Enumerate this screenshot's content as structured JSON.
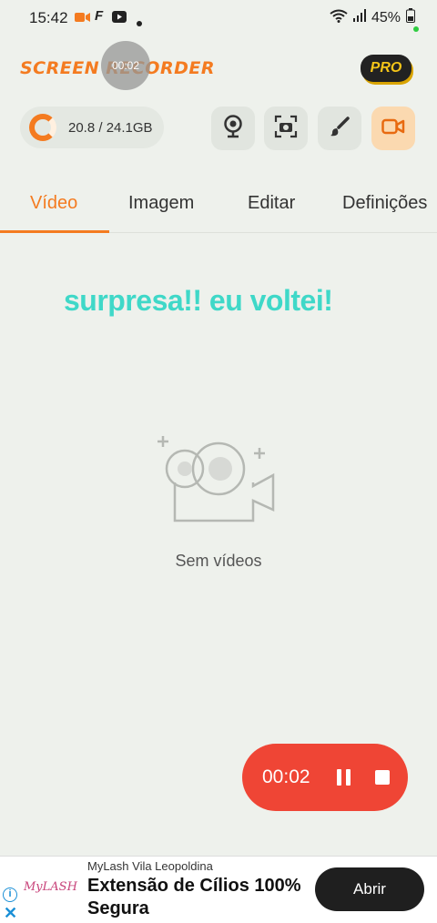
{
  "status_bar": {
    "time": "15:42",
    "battery": "45%",
    "icons": [
      "record-icon",
      "f-icon",
      "youtube-icon",
      "dot-icon",
      "wifi-icon",
      "signal-icon",
      "battery-icon"
    ]
  },
  "header": {
    "logo_text": "SCREEN RECORDER",
    "overlay_timer": "00:02",
    "pro_label": "PRO"
  },
  "storage": {
    "used": "20.8",
    "total": "24.1GB",
    "text": "20.8 / 24.1GB"
  },
  "mode_buttons": [
    "webcam-icon",
    "screenshot-icon",
    "brush-icon",
    "video-record-icon"
  ],
  "tabs": [
    {
      "label": "Vídeo",
      "active": true
    },
    {
      "label": "Imagem",
      "active": false
    },
    {
      "label": "Editar",
      "active": false
    },
    {
      "label": "Definições",
      "active": false
    }
  ],
  "overlay_text": "surpresa!! eu voltei!",
  "empty_state": {
    "label": "Sem vídeos"
  },
  "recording": {
    "time": "00:02"
  },
  "ad": {
    "advertiser": "MyLash Vila Leopoldina",
    "headline": "Extensão de Cílios 100% Segura",
    "logo_text": "MyLASH",
    "cta": "Abrir"
  },
  "colors": {
    "accent": "#f47b20",
    "record_red": "#ef4535",
    "overlay_text": "#3fd8c8",
    "background": "#eef1ec"
  }
}
